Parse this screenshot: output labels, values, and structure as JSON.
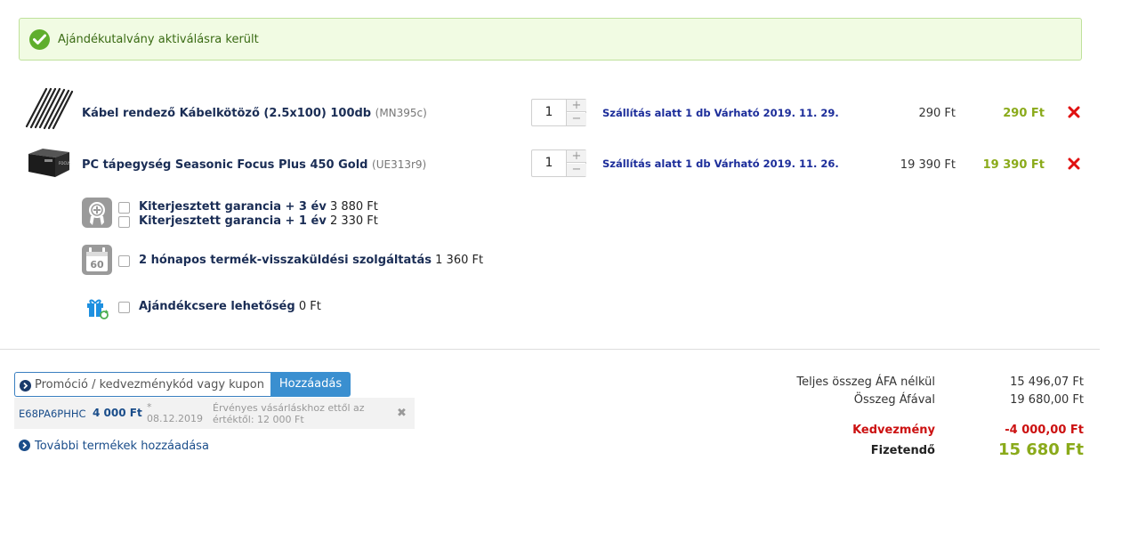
{
  "alert": {
    "text": "Ajándékutalvány aktiválásra került"
  },
  "cart": {
    "items": [
      {
        "name": "Kábel rendező Kábelkötöző (2.5x100) 100db",
        "code": "(MN395c)",
        "quantity": "1",
        "shipping": "Szállítás alatt 1 db Várható 2019. 11. 29.",
        "unit_price": "290 Ft",
        "total_price": "290 Ft"
      },
      {
        "name": "PC tápegység Seasonic Focus Plus 450 Gold",
        "code": "(UE313r9)",
        "quantity": "1",
        "shipping": "Szállítás alatt 1 db Várható 2019. 11. 26.",
        "unit_price": "19 390 Ft",
        "total_price": "19 390 Ft"
      }
    ],
    "qty_plus": "+",
    "qty_minus": "−",
    "remove_icon": "red-x-icon"
  },
  "services": {
    "warranty": [
      {
        "label": "Kiterjesztett garancia + 3 év",
        "price": "3 880 Ft"
      },
      {
        "label": "Kiterjesztett garancia + 1 év",
        "price": "2 330 Ft"
      }
    ],
    "return": {
      "label": "2 hónapos termék-visszaküldési szolgáltatás",
      "price": "1 360 Ft",
      "icon_text": "60"
    },
    "gift": {
      "label": "Ajándékcsere lehetőség",
      "price": "0 Ft"
    }
  },
  "promo": {
    "placeholder": "Promóció / kedvezménykód vagy kupon",
    "button": "Hozzáadás",
    "coupon": {
      "code": "E68PA6PHHC",
      "amount": "4 000 Ft",
      "date_marker": "*",
      "date": "08.12.2019",
      "note": "Érvényes vásárláskhoz ettől az értéktől: 12 000 Ft",
      "remove": "✖"
    }
  },
  "more_link": "További termékek hozzáadása",
  "summary": {
    "net_label": "Teljes összeg ÁFA nélkül",
    "net_value": "15 496,07 Ft",
    "gross_label": "Összeg Áfával",
    "gross_value": "19 680,00 Ft",
    "discount_label": "Kedvezmény",
    "discount_value": "-4 000,00 Ft",
    "pay_label": "Fizetendő",
    "pay_value": "15 680 Ft"
  },
  "colors": {
    "success_bg": "#f1fbe3",
    "success_icon": "#5fae2c",
    "price_green": "#8aaa1a",
    "remove_red": "#e01010",
    "button_blue": "#3a8fd0",
    "discount_red": "#cc1111"
  }
}
